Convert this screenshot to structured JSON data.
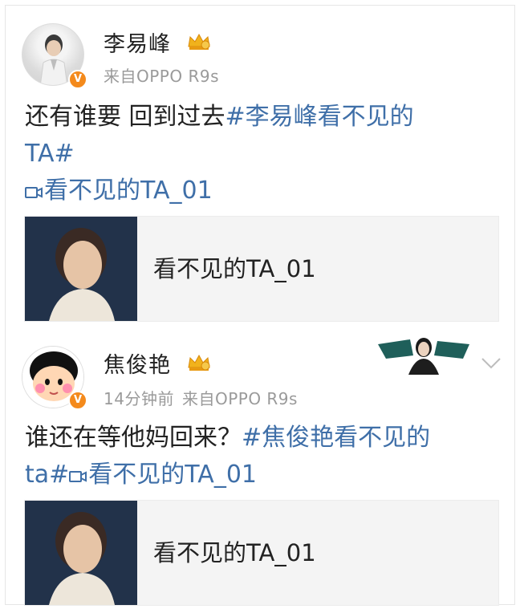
{
  "posts": [
    {
      "author": "李易峰",
      "time": "",
      "source": "来自OPPO R9s",
      "text_plain": "还有谁要 回到过去",
      "hashtag": "#李易峰看不见的",
      "hashtag_cont": "TA#",
      "video_link": "看不见的TA_01",
      "card_title": "看不见的TA_01",
      "verified_badge": "V"
    },
    {
      "author": "焦俊艳",
      "time": "14分钟前",
      "source": "来自OPPO R9s",
      "text_plain": "谁还在等他妈回来？",
      "hashtag": "#焦俊艳看不见的",
      "hashtag_cont": "ta#",
      "video_link": "看不见的TA_01",
      "card_title": "看不见的TA_01",
      "verified_badge": "V"
    }
  ],
  "icons": {
    "crown": "crown-icon",
    "video": "video-icon",
    "chevron": "chevron-down-icon"
  },
  "colors": {
    "link": "#3f6fa8",
    "meta": "#9a9a9a",
    "badge": "#f48a1c"
  }
}
